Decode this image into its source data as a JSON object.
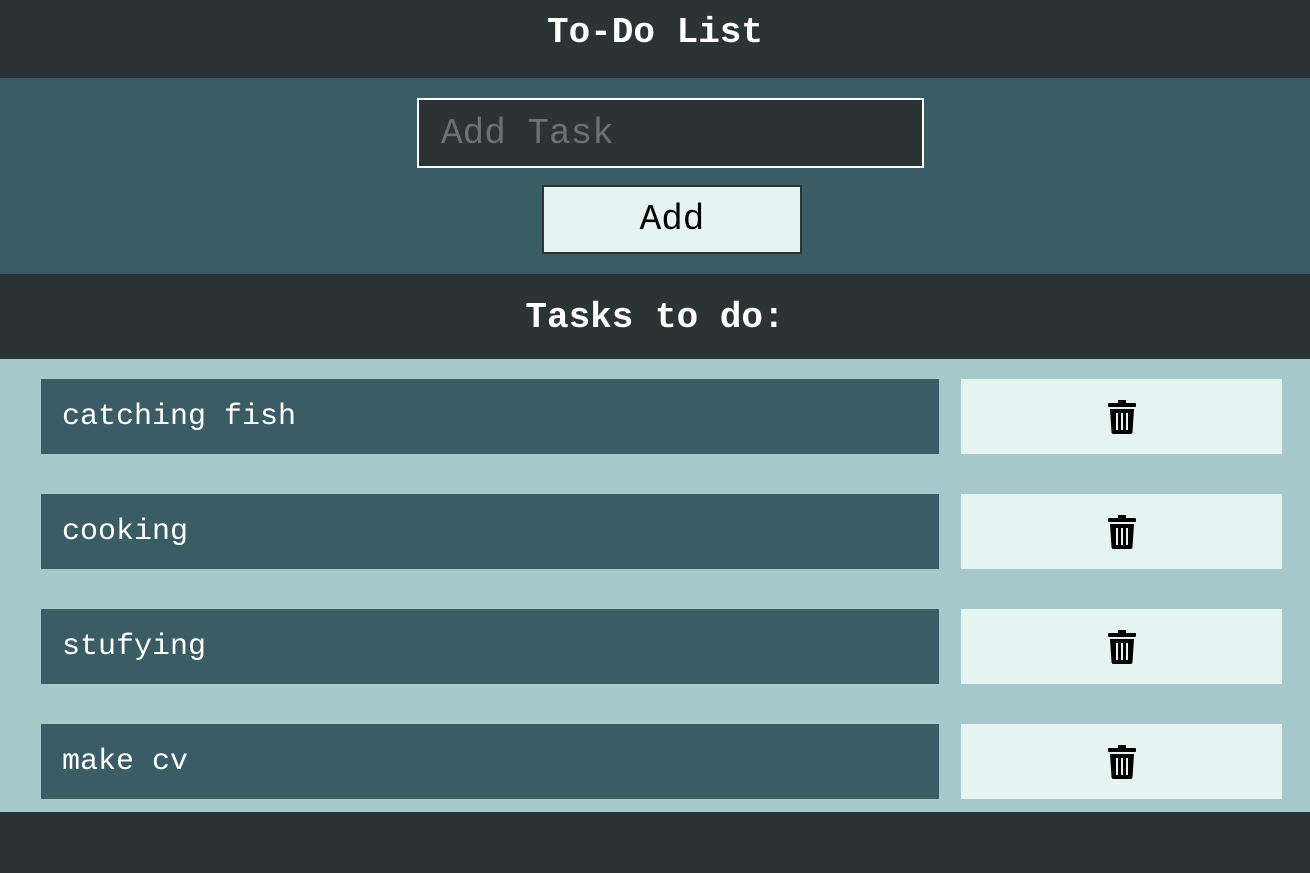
{
  "app": {
    "title": "To-Do List"
  },
  "add_form": {
    "input_placeholder": "Add Task",
    "input_value": "",
    "add_label": "Add"
  },
  "tasks_section": {
    "heading": "Tasks to do:"
  },
  "tasks": [
    {
      "text": "catching fish",
      "delete_icon": "trash-icon"
    },
    {
      "text": "cooking",
      "delete_icon": "trash-icon"
    },
    {
      "text": "stufying",
      "delete_icon": "trash-icon"
    },
    {
      "text": "make cv",
      "delete_icon": "trash-icon"
    }
  ],
  "colors": {
    "dark": "#2b3334",
    "teal": "#3a5c65",
    "light_teal": "#a5c8cb",
    "button_bg": "#e6f4f1",
    "text_light": "#ffffff",
    "placeholder": "#6b7273"
  }
}
